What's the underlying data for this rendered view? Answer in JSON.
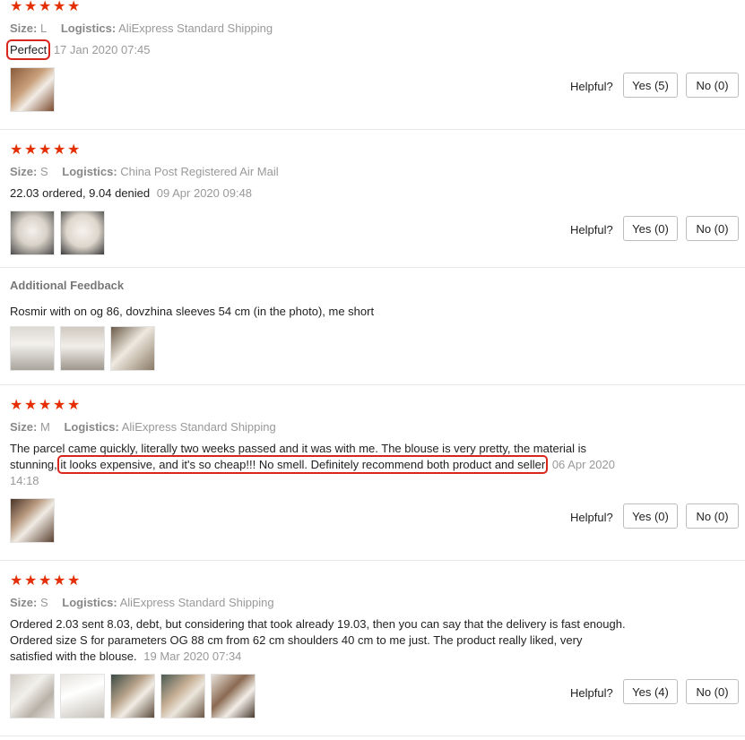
{
  "helpful_label": "Helpful?",
  "size_label": "Size:",
  "logistics_label": "Logistics:",
  "reviews": [
    {
      "stars": 5,
      "size": "L",
      "logistics": "AliExpress Standard Shipping",
      "text": "Perfect",
      "date": "17 Jan 2020 07:45",
      "yes": "Yes (5)",
      "no": "No (0)"
    },
    {
      "stars": 5,
      "size": "S",
      "logistics": "China Post Registered Air Mail",
      "text": "22.03 ordered, 9.04 denied",
      "date": "09 Apr 2020 09:48",
      "yes": "Yes (0)",
      "no": "No (0)",
      "additional_title": "Additional Feedback",
      "additional_text": "Rosmir with on og 86, dovzhina sleeves 54 cm (in the photo), me short"
    },
    {
      "stars": 5,
      "size": "M",
      "logistics": "AliExpress Standard Shipping",
      "text_a": "The parcel came quickly, literally two weeks passed and it was with me. The blouse is very pretty, the material is",
      "text_b": "stunning,",
      "text_highlight": "it looks expensive, and it's so cheap!!! No smell. Definitely recommend both product and seller",
      "date_a": "06 Apr 2020",
      "date_b": "14:18",
      "yes": "Yes (0)",
      "no": "No (0)"
    },
    {
      "stars": 5,
      "size": "S",
      "logistics": "AliExpress Standard Shipping",
      "text_l1": "Ordered 2.03 sent 8.03, debt, but considering that took already 19.03, then you can say that the delivery is fast enough.",
      "text_l2": "Ordered size S for parameters OG 88 cm from 62 cm shoulders 40 cm to me just. The product really liked, very",
      "text_l3": "satisfied with the blouse.",
      "date": "19 Mar 2020 07:34",
      "yes": "Yes (4)",
      "no": "No (0)"
    }
  ]
}
